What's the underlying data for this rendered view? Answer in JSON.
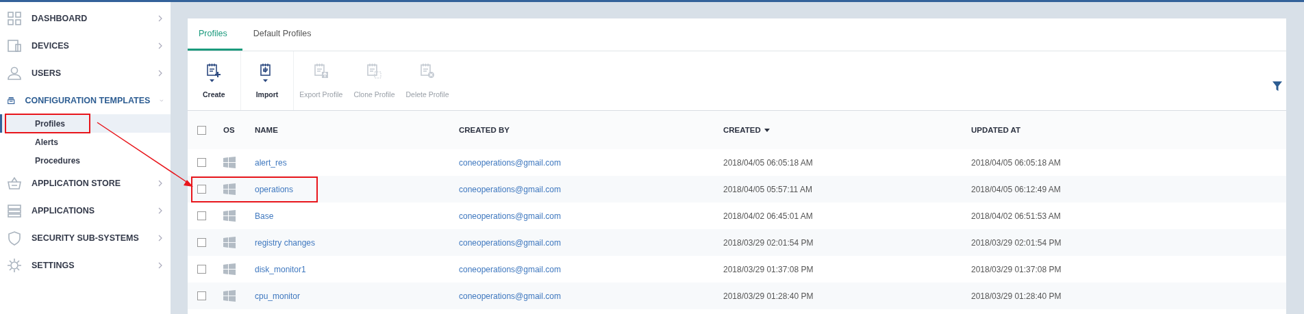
{
  "sidebar": {
    "items": [
      {
        "label": "DASHBOARD",
        "expanded": false
      },
      {
        "label": "DEVICES",
        "expanded": false
      },
      {
        "label": "USERS",
        "expanded": false
      },
      {
        "label": "CONFIGURATION TEMPLATES",
        "expanded": true,
        "children": [
          {
            "label": "Profiles",
            "selected": true,
            "highlighted": true
          },
          {
            "label": "Alerts",
            "selected": false,
            "highlighted": false
          },
          {
            "label": "Procedures",
            "selected": false,
            "highlighted": false
          }
        ]
      },
      {
        "label": "APPLICATION STORE",
        "expanded": false
      },
      {
        "label": "APPLICATIONS",
        "expanded": false
      },
      {
        "label": "SECURITY SUB-SYSTEMS",
        "expanded": false
      },
      {
        "label": "SETTINGS",
        "expanded": false
      }
    ]
  },
  "tabs": [
    {
      "label": "Profiles",
      "selected": true
    },
    {
      "label": "Default Profiles",
      "selected": false
    }
  ],
  "toolbar": [
    {
      "label": "Create",
      "disabled": false
    },
    {
      "label": "Import",
      "disabled": false
    },
    {
      "label": "Export Profile",
      "disabled": true
    },
    {
      "label": "Clone Profile",
      "disabled": true
    },
    {
      "label": "Delete Profile",
      "disabled": true
    }
  ],
  "table": {
    "select_all": {
      "checked": false
    },
    "columns": [
      {
        "label": "OS",
        "sorted": false
      },
      {
        "label": "NAME",
        "sorted": false
      },
      {
        "label": "CREATED BY",
        "sorted": false
      },
      {
        "label": "CREATED",
        "sorted": true
      },
      {
        "label": "UPDATED AT",
        "sorted": false
      }
    ],
    "rows": [
      {
        "checked": false,
        "highlighted": false,
        "name": "alert_res",
        "created_by": "coneoperations@gmail.com",
        "created": "2018/04/05 06:05:18 AM",
        "updated_at": "2018/04/05 06:05:18 AM"
      },
      {
        "checked": false,
        "highlighted": true,
        "name": "operations",
        "created_by": "coneoperations@gmail.com",
        "created": "2018/04/05 05:57:11 AM",
        "updated_at": "2018/04/05 06:12:49 AM"
      },
      {
        "checked": false,
        "highlighted": false,
        "name": "Base",
        "created_by": "coneoperations@gmail.com",
        "created": "2018/04/02 06:45:01 AM",
        "updated_at": "2018/04/02 06:51:53 AM"
      },
      {
        "checked": false,
        "highlighted": false,
        "name": "registry changes",
        "created_by": "coneoperations@gmail.com",
        "created": "2018/03/29 02:01:54 PM",
        "updated_at": "2018/03/29 02:01:54 PM"
      },
      {
        "checked": false,
        "highlighted": false,
        "name": "disk_monitor1",
        "created_by": "coneoperations@gmail.com",
        "created": "2018/03/29 01:37:08 PM",
        "updated_at": "2018/03/29 01:37:08 PM"
      },
      {
        "checked": false,
        "highlighted": false,
        "name": "cpu_monitor",
        "created_by": "coneoperations@gmail.com",
        "created": "2018/03/29 01:28:40 PM",
        "updated_at": "2018/03/29 01:28:40 PM"
      }
    ]
  },
  "annotation_arrow": true
}
